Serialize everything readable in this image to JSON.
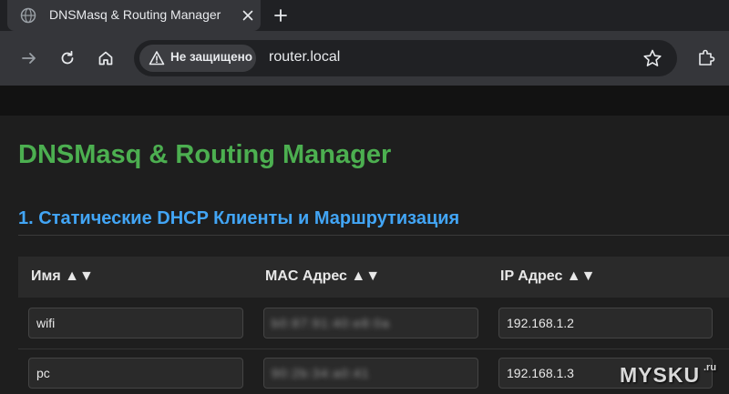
{
  "browser": {
    "tab": {
      "title": "DNSMasq & Routing Manager",
      "favicon": "globe-icon"
    },
    "new_tab_icon": "plus-icon",
    "address_bar": {
      "security_label": "Не защищено",
      "url": "router.local"
    }
  },
  "page": {
    "title": "DNSMasq & Routing Manager",
    "section_title": "1. Статические DHCP Клиенты и Маршрутизация",
    "table": {
      "columns": [
        {
          "label": "Имя ▲▼"
        },
        {
          "label": "MAC Адрес ▲▼"
        },
        {
          "label": "IP Адрес ▲▼"
        }
      ],
      "rows": [
        {
          "name": "wifi",
          "mac": "b0:87:91:40:e8:0a",
          "ip": "192.168.1.2"
        },
        {
          "name": "pc",
          "mac": "90:2b:34:a0:41",
          "ip": "192.168.1.3"
        }
      ]
    }
  },
  "watermark": {
    "text": "MYSKU",
    "suffix": ".ru"
  },
  "colors": {
    "title_green": "#4caf50",
    "section_blue": "#42a5f5",
    "panel_bg": "#1e1e1e",
    "header_bg": "#2a2a2a"
  }
}
